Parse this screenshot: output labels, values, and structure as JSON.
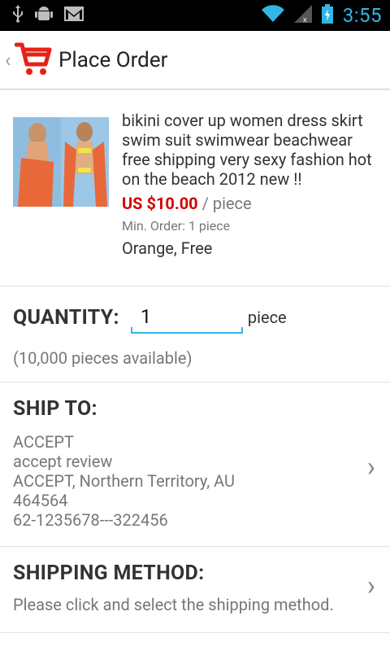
{
  "status_bar": {
    "time": "3:55",
    "icons": [
      "usb-icon",
      "android-debug-icon",
      "gmail-icon",
      "wifi-icon",
      "signal-icon",
      "battery-icon"
    ]
  },
  "action_bar": {
    "title": "Place Order",
    "logo": "cart-logo-icon"
  },
  "product": {
    "title": "bikini cover up  women dress skirt swim suit swimwear beachwear  free shipping very sexy fashion  hot on the beach 2012 new !!",
    "price": "US $10.00",
    "per_unit": "/ piece",
    "min_order": "Min. Order: 1 piece",
    "variant": "Orange, Free"
  },
  "quantity": {
    "label": "QUANTITY:",
    "value": "1",
    "unit": "piece",
    "available": "(10,000 pieces available)"
  },
  "ship_to": {
    "label": "SHIP TO:",
    "lines": [
      "ACCEPT",
      "accept review",
      "ACCEPT, Northern Territory, AU",
      "464564",
      "62-1235678---322456"
    ]
  },
  "shipping_method": {
    "label": "SHIPPING METHOD:",
    "hint": "Please click and select the shipping method."
  },
  "colors": {
    "accent": "#33b5e5",
    "price": "#d40000",
    "logo_red": "#e62117"
  }
}
